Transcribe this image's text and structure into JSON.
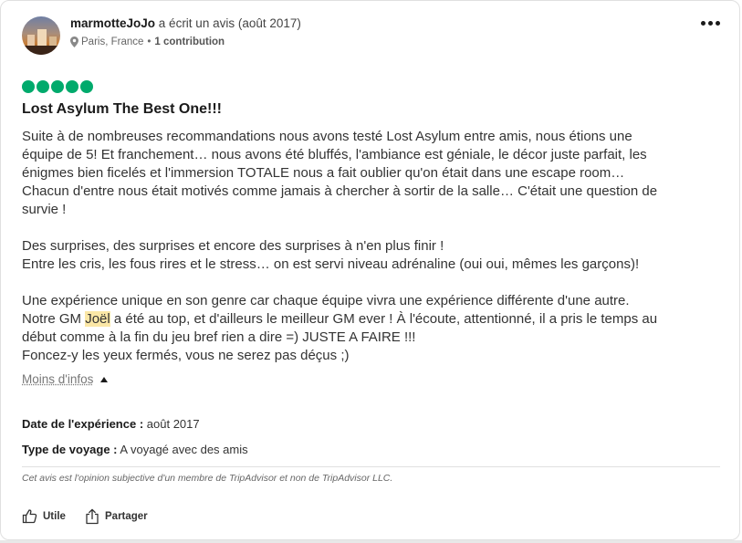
{
  "review": {
    "username": "marmotteJoJo",
    "wrote_text": "a écrit un avis (août 2017)",
    "location": "Paris, France",
    "separator": "•",
    "contributions": "1 contribution",
    "rating_bubbles": 5,
    "rating_color": "#00aa6c",
    "title": "Lost Asylum The Best One!!!",
    "body": {
      "line1": "Suite à de nombreuses recommandations nous avons testé Lost Asylum entre amis, nous étions une",
      "line2": "équipe de 5! Et franchement… nous avons été bluffés, l'ambiance est géniale, le décor juste parfait, les",
      "line3": "énigmes bien ficelés et l'immersion TOTALE nous a fait oublier qu'on était dans une escape room…",
      "line4": "Chacun d'entre nous était motivés comme jamais à chercher à sortir de la salle… C'était une question de",
      "line5": "survie !",
      "line6": "Des surprises, des surprises et encore des surprises à n'en plus finir !",
      "line7": "Entre les cris, les fous rires et le stress… on est servi niveau adrénaline (oui oui, mêmes les garçons)!",
      "line8": "Une expérience unique en son genre car chaque équipe vivra une expérience différente d'une autre.",
      "line9_pre": "Notre GM ",
      "line9_highlight": "Joël",
      "line9_post": " a été au top, et d'ailleurs le meilleur GM ever ! À l'écoute, attentionné, il a pris le temps au",
      "line10": "début comme à la fin du jeu bref rien a dire =) JUSTE A FAIRE !!!",
      "line11": "Foncez-y les yeux fermés, vous ne serez pas déçus ;)"
    },
    "less_info": "Moins d'infos",
    "experience_date_label": "Date de l'expérience :",
    "experience_date_value": "août 2017",
    "trip_type_label": "Type de voyage :",
    "trip_type_value": "A voyagé avec des amis",
    "disclaimer": "Cet avis est l'opinion subjective d'un membre de TripAdvisor et non de TripAdvisor LLC.",
    "like_label": "Utile",
    "share_label": "Partager"
  },
  "icons": {
    "more": "more-options-icon",
    "pin": "location-pin-icon",
    "like": "thumbs-up-icon",
    "share": "share-icon",
    "caret": "caret-up-icon"
  }
}
